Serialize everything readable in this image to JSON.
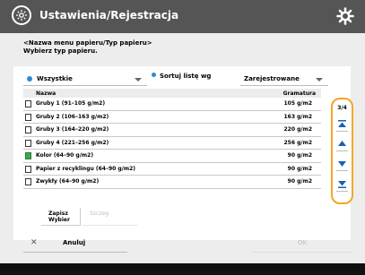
{
  "header": {
    "title": "Ustawienia/Rejestracja",
    "logo_icon": "settings-logo-icon",
    "gear_icon": "gear-icon"
  },
  "instruction": {
    "line1": "<Nazwa menu papieru/Typ papieru>",
    "line2": "Wybierz typ papieru."
  },
  "filters": {
    "all_label": "Wszystkie",
    "sort_check_label": "Sortuj listę wg",
    "sort_label": "Zarejestrowane"
  },
  "list": {
    "col_name": "Nazwa",
    "col_weight": "Gramatura",
    "rows": [
      {
        "name": "Gruby 1 (91–105 g/m2)",
        "weight": "105 g/m2",
        "icon": "paper-icon"
      },
      {
        "name": "Gruby 2 (106–163 g/m2)",
        "weight": "163 g/m2",
        "icon": "paper-icon"
      },
      {
        "name": "Gruby 3 (164–220 g/m2)",
        "weight": "220 g/m2",
        "icon": "paper-icon"
      },
      {
        "name": "Gruby 4 (221–256 g/m2)",
        "weight": "256 g/m2",
        "icon": "paper-icon"
      },
      {
        "name": "Kolor (64–90 g/m2)",
        "weight": "90 g/m2",
        "icon": "color-paper-icon"
      },
      {
        "name": "Papier z recyklingu (64–90 g/m2)",
        "weight": "90 g/m2",
        "icon": "paper-icon"
      },
      {
        "name": "Zwykły (64–90 g/m2)",
        "weight": "90 g/m2",
        "icon": "paper-icon"
      }
    ]
  },
  "scroll": {
    "page": "3/4"
  },
  "buttons": {
    "keep_line1": "Zapisz",
    "keep_line2": "Wybier",
    "disabled": "Szczeg.",
    "cancel": "Anuluj",
    "ok": "OK"
  },
  "colors": {
    "header_bg": "#555555",
    "accent_blue": "#2a8bd8",
    "scroll_highlight": "#f5a623"
  }
}
